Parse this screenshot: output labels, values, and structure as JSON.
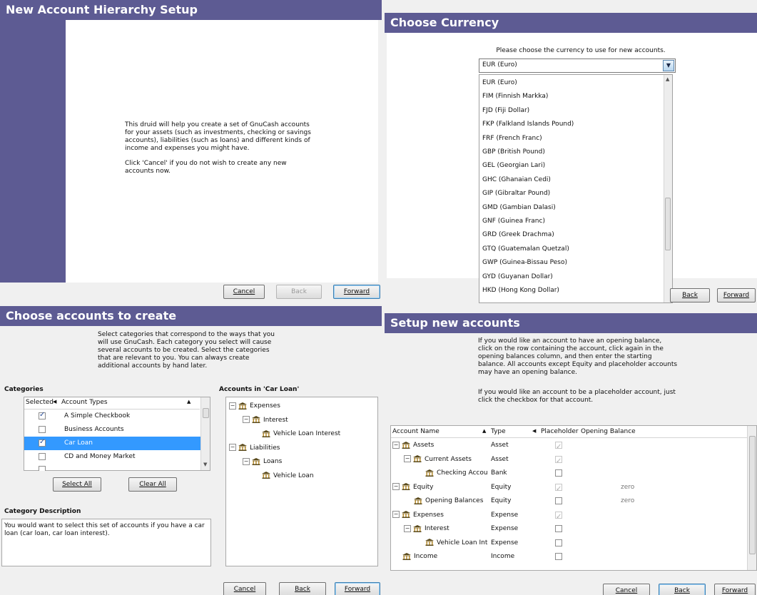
{
  "panel1": {
    "title": "New Account Hierarchy Setup",
    "body1": "This druid will help you create a set of GnuCash accounts for your assets (such as investments, checking or savings accounts), liabilities (such as loans) and different kinds of income and expenses you might have.",
    "body2": "Click 'Cancel'  if you do not wish to create any new accounts now.",
    "cancel": "Cancel",
    "back": "Back",
    "forward": "Forward"
  },
  "panel2": {
    "title": "Choose Currency",
    "prompt": "Please choose the currency to use for new accounts.",
    "selected": "EUR (Euro)",
    "options": [
      "EUR (Euro)",
      "FIM (Finnish Markka)",
      "FJD (Fiji Dollar)",
      "FKP (Falkland Islands Pound)",
      "FRF (French Franc)",
      "GBP (British Pound)",
      "GEL (Georgian Lari)",
      "GHC (Ghanaian Cedi)",
      "GIP (Gibraltar Pound)",
      "GMD (Gambian Dalasi)",
      "GNF (Guinea Franc)",
      "GRD (Greek Drachma)",
      "GTQ (Guatemalan Quetzal)",
      "GWP (Guinea-Bissau Peso)",
      "GYD (Guyanan Dollar)",
      "HKD (Hong Kong Dollar)"
    ],
    "back": "Back",
    "forward": "Forward"
  },
  "panel3": {
    "title": "Choose accounts to create",
    "intro": "Select categories that correspond to the ways that you will use GnuCash. Each category you select will cause several accounts to be created.  Select the categories that are relevant to you.  You can always create additional accounts by hand later.",
    "categories_label": "Categories",
    "col_selected": "Selected",
    "col_types": "Account Types",
    "categories": [
      {
        "label": "A Simple Checkbook",
        "checked": true
      },
      {
        "label": "Business Accounts",
        "checked": false
      },
      {
        "label": "Car Loan",
        "checked": true
      },
      {
        "label": "CD and Money Market",
        "checked": false
      }
    ],
    "select_all": "Select All",
    "clear_all": "Clear All",
    "accounts_label": "Accounts in 'Car Loan'",
    "tree": [
      "Expenses",
      "Interest",
      "Vehicle Loan Interest",
      "Liabilities",
      "Loans",
      "Vehicle Loan"
    ],
    "desc_label": "Category Description",
    "description": "You would want to select this set of accounts if you have a car loan (car loan, car loan interest).",
    "cancel": "Cancel",
    "back": "Back",
    "forward": "Forward"
  },
  "panel4": {
    "title": "Setup new accounts",
    "intro1": "If you would like an account to have an opening balance, click on the row containing the account, click again in the opening balances column, and then enter the starting balance. All accounts except Equity and placeholder accounts may have an opening balance.",
    "intro2": "If you would like an account to be a placeholder account, just click the checkbox for that account.",
    "col_name": "Account Name",
    "col_type": "Type",
    "col_placeholder": "Placeholder",
    "col_balance": "Opening Balance",
    "rows": [
      {
        "name": "Assets",
        "type": "Asset",
        "placeholder": true,
        "balance": ""
      },
      {
        "name": "Current Assets",
        "type": "Asset",
        "placeholder": true,
        "balance": ""
      },
      {
        "name": "Checking Accou",
        "type": "Bank",
        "placeholder": false,
        "balance": ""
      },
      {
        "name": "Equity",
        "type": "Equity",
        "placeholder": true,
        "balance": "zero"
      },
      {
        "name": "Opening Balances",
        "type": "Equity",
        "placeholder": false,
        "balance": "zero"
      },
      {
        "name": "Expenses",
        "type": "Expense",
        "placeholder": true,
        "balance": ""
      },
      {
        "name": "Interest",
        "type": "Expense",
        "placeholder": false,
        "balance": ""
      },
      {
        "name": "Vehicle Loan Inte",
        "type": "Expense",
        "placeholder": false,
        "balance": ""
      },
      {
        "name": "Income",
        "type": "Income",
        "placeholder": false,
        "balance": ""
      }
    ],
    "cancel": "Cancel",
    "back": "Back",
    "forward": "Forward"
  }
}
